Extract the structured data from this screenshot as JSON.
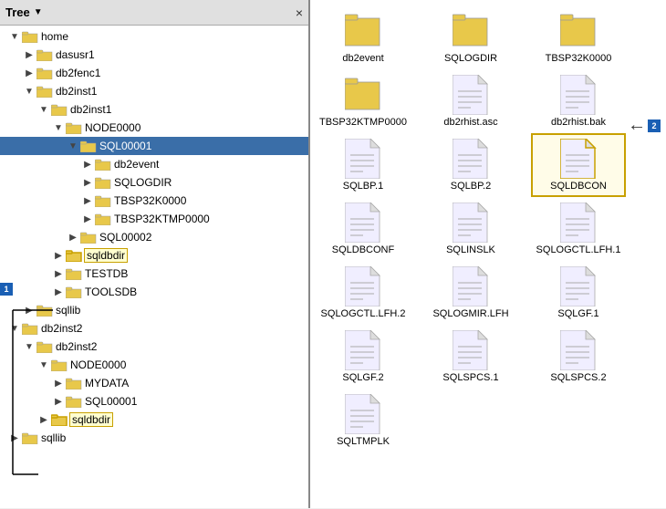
{
  "tree": {
    "title": "Tree",
    "close_label": "×",
    "items": [
      {
        "id": "home",
        "label": "home",
        "level": 0,
        "expanded": true,
        "type": "folder"
      },
      {
        "id": "dasusr1",
        "label": "dasusr1",
        "level": 1,
        "expanded": false,
        "type": "folder"
      },
      {
        "id": "db2fenc1",
        "label": "db2fenc1",
        "level": 1,
        "expanded": false,
        "type": "folder"
      },
      {
        "id": "db2inst1",
        "label": "db2inst1",
        "level": 1,
        "expanded": true,
        "type": "folder"
      },
      {
        "id": "db2inst1_sub",
        "label": "db2inst1",
        "level": 2,
        "expanded": true,
        "type": "folder"
      },
      {
        "id": "node0000",
        "label": "NODE0000",
        "level": 3,
        "expanded": true,
        "type": "folder"
      },
      {
        "id": "sql00001",
        "label": "SQL00001",
        "level": 4,
        "expanded": true,
        "type": "folder",
        "selected": true
      },
      {
        "id": "db2event",
        "label": "db2event",
        "level": 5,
        "expanded": false,
        "type": "folder"
      },
      {
        "id": "sqlogdir",
        "label": "SQLOGDIR",
        "level": 5,
        "expanded": false,
        "type": "folder"
      },
      {
        "id": "tbsp32k0000",
        "label": "TBSP32K0000",
        "level": 5,
        "expanded": false,
        "type": "folder"
      },
      {
        "id": "tbsp32ktmp0000",
        "label": "TBSP32KTMP0000",
        "level": 5,
        "expanded": false,
        "type": "folder"
      },
      {
        "id": "sql00002",
        "label": "SQL00002",
        "level": 4,
        "expanded": false,
        "type": "folder"
      },
      {
        "id": "sqldbdir1",
        "label": "sqldbdir",
        "level": 3,
        "expanded": false,
        "type": "folder",
        "highlighted": true
      },
      {
        "id": "testdb",
        "label": "TESTDB",
        "level": 3,
        "expanded": false,
        "type": "folder"
      },
      {
        "id": "toolsdb",
        "label": "TOOLSDB",
        "level": 3,
        "expanded": false,
        "type": "folder"
      },
      {
        "id": "sqllib1",
        "label": "sqllib",
        "level": 1,
        "expanded": false,
        "type": "folder"
      },
      {
        "id": "db2inst2",
        "label": "db2inst2",
        "level": 0,
        "expanded": true,
        "type": "folder"
      },
      {
        "id": "db2inst2_sub",
        "label": "db2inst2",
        "level": 1,
        "expanded": true,
        "type": "folder"
      },
      {
        "id": "node0000_2",
        "label": "NODE0000",
        "level": 2,
        "expanded": true,
        "type": "folder"
      },
      {
        "id": "mydata",
        "label": "MYDATA",
        "level": 3,
        "expanded": false,
        "type": "folder"
      },
      {
        "id": "sql00001_2",
        "label": "SQL00001",
        "level": 3,
        "expanded": false,
        "type": "folder"
      },
      {
        "id": "sqldbdir2",
        "label": "sqldbdir",
        "level": 2,
        "expanded": false,
        "type": "folder",
        "highlighted": true
      },
      {
        "id": "sqllib2",
        "label": "sqllib",
        "level": 0,
        "expanded": false,
        "type": "folder"
      }
    ]
  },
  "files": [
    {
      "name": "db2event",
      "type": "folder"
    },
    {
      "name": "SQLOGDIR",
      "type": "folder"
    },
    {
      "name": "TBSP32K0000",
      "type": "folder"
    },
    {
      "name": "TBSP32KTMP0000",
      "type": "folder"
    },
    {
      "name": "db2rhist.asc",
      "type": "document"
    },
    {
      "name": "db2rhist.bak",
      "type": "document"
    },
    {
      "name": "SQLBP.1",
      "type": "document"
    },
    {
      "name": "SQLBP.2",
      "type": "document"
    },
    {
      "name": "SQLDBCON",
      "type": "document",
      "selected": true
    },
    {
      "name": "SQLDBCONF",
      "type": "document"
    },
    {
      "name": "SQLINSLK",
      "type": "document"
    },
    {
      "name": "SQLOGCTL.LFH.1",
      "type": "document"
    },
    {
      "name": "SQLOGCTL.LFH.2",
      "type": "document"
    },
    {
      "name": "SQLOGMIR.LFH",
      "type": "document"
    },
    {
      "name": "SQLGF.1",
      "type": "document"
    },
    {
      "name": "SQLGF.2",
      "type": "document"
    },
    {
      "name": "SQLSPCS.1",
      "type": "document"
    },
    {
      "name": "SQLSPCS.2",
      "type": "document"
    },
    {
      "name": "SQLTMPLK",
      "type": "document"
    }
  ],
  "annotations": {
    "badge1": "1",
    "badge2": "2"
  }
}
